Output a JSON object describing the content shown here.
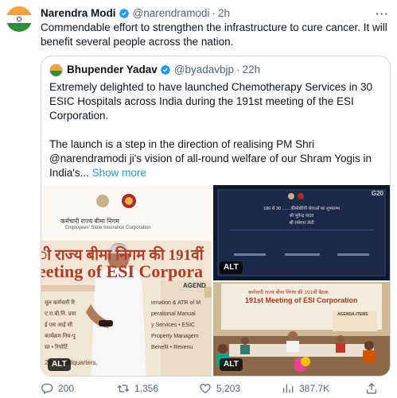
{
  "tweet": {
    "author_name": "Narendra Modi",
    "handle": "@narendramodi",
    "separator": "·",
    "time": "2h",
    "more": "···",
    "text": "Commendable effort to strengthen the infrastructure to cure cancer. It will benefit several people across the nation."
  },
  "quote": {
    "author_name": "Bhupender Yadav",
    "handle": "@byadavbjp",
    "separator": "·",
    "time": "22h",
    "paragraph1": "Extremely delighted to have launched Chemotherapy Services in 30 ESIC Hospitals across India during the 191st meeting of the ESI Corporation.",
    "paragraph2": "The launch is a step in the direction of realising PM Shri @narendramodi ji's vision of all-round welfare of our Shram Yogis in India's...",
    "show_more": "Show more"
  },
  "media": {
    "alt_label": "ALT",
    "left_banner_org_hindi": "कर्मचारी राज्य बीमा निगम",
    "left_banner_org_english": "Employees' State Insurance Corporation",
    "left_banner_line1": "ी राज्य बीमा निगम की 191वीं",
    "left_banner_line2": "eeting of ESI Corpora",
    "left_agenda": "AGEND",
    "left_list": [
      "मूल कर्मचारी रि",
      "ए.रा.बी.नि. प्रया",
      "ई एस आई सी",
      "कार्यक्रम निय-पु",
      "स्त • रिपोर्टि"
    ],
    "left_list_right": [
      "irmation & ATR of M",
      "perational Manual",
      "y Services • ESIC",
      "Property Managem",
      "Benefit • Revenu"
    ],
    "left_footer": "23 • Headquarters,",
    "tr_label": "G20",
    "tr_lines": [
      "180 से 30 ...... कीमोथेरेपी सेवाओं का शुभारम्भ",
      "श्री भूपेन्द्र यादव",
      "श्री रामेश्वर तेली"
    ],
    "br_title_hindi": "कर्मचारी राज्य बीमा निगम की 191वीं बैठक",
    "br_title_english": "191st Meeting of ESI Corporation",
    "br_agenda": "AGENDA-ITEMS"
  },
  "actions": {
    "replies": "200",
    "retweets": "1,356",
    "likes": "5,203",
    "views": "387.7K"
  },
  "colors": {
    "link": "#1d9bf0",
    "muted": "#536471",
    "verified": "#1d9bf0"
  }
}
